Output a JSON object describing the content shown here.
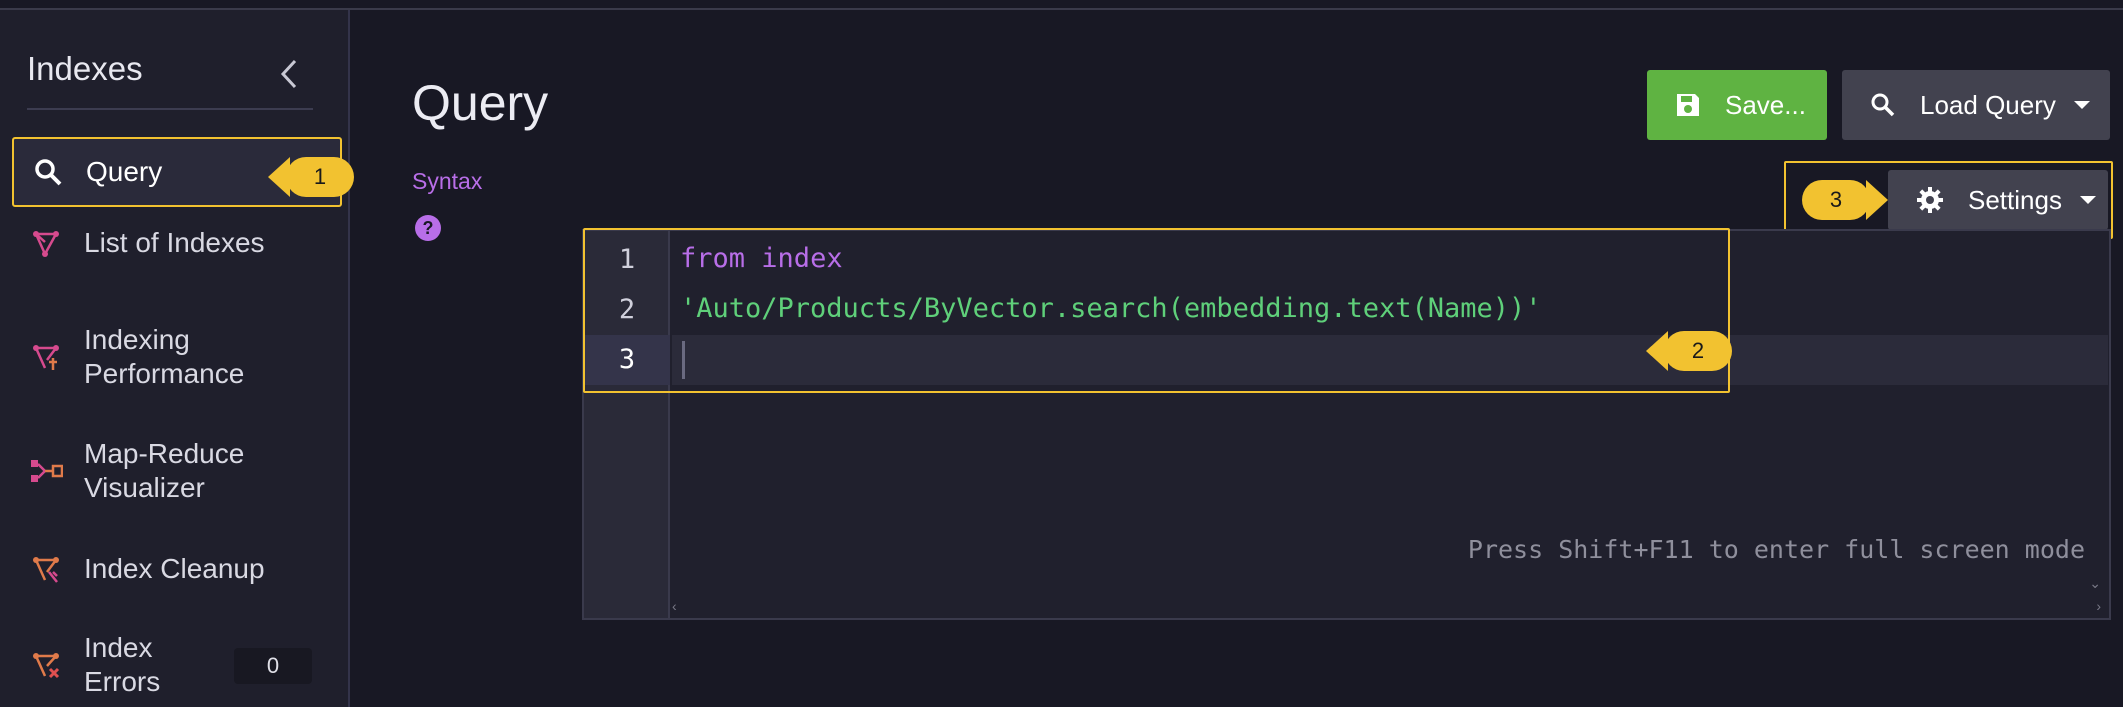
{
  "sidebar": {
    "title": "Indexes",
    "items": [
      {
        "label": "Query",
        "icon": "search-icon"
      },
      {
        "label": "List of Indexes",
        "icon": "index-list-icon"
      },
      {
        "label1": "Indexing",
        "label2": "Performance",
        "icon": "indexing-performance-icon"
      },
      {
        "label1": "Map-Reduce",
        "label2": "Visualizer",
        "icon": "map-reduce-icon"
      },
      {
        "label": "Index Cleanup",
        "icon": "index-cleanup-icon"
      },
      {
        "label1": "Index",
        "label2": "Errors",
        "icon": "index-errors-icon",
        "badge": "0"
      }
    ]
  },
  "main": {
    "title": "Query",
    "syntax_link": "Syntax",
    "save_label": "Save...",
    "load_label": "Load Query",
    "settings_label": "Settings"
  },
  "editor": {
    "line_numbers": [
      "1",
      "2",
      "3"
    ],
    "line1_keyword1": "from",
    "line1_keyword2": "index",
    "line2_string": "'Auto/Products/ByVector.search(embedding.text(Name))'",
    "fullscreen_hint": "Press Shift+F11 to enter full screen mode"
  },
  "callouts": [
    "1",
    "2",
    "3"
  ],
  "colors": {
    "accent_yellow": "#f2c230",
    "save_green": "#5fb342",
    "keyword_purple": "#b86ee8",
    "string_green": "#5fd07a"
  }
}
